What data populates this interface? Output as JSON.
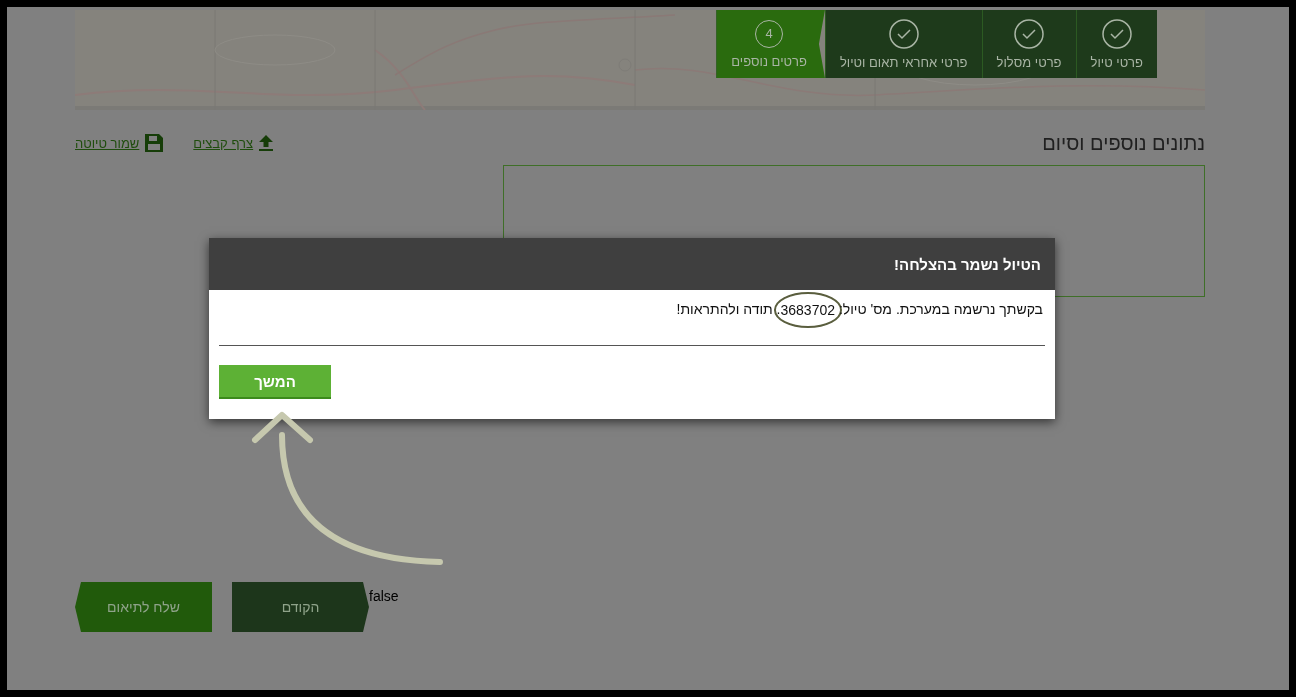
{
  "steps": [
    {
      "label": "פרטי טיול",
      "done": true,
      "selected": false
    },
    {
      "label": "פרטי מסלול",
      "done": true,
      "selected": false
    },
    {
      "label": "פרטי אחראי תאום וטיול",
      "done": true,
      "selected": false
    },
    {
      "label": "פרטים נוספים",
      "done": false,
      "number": "4",
      "selected": true
    }
  ],
  "section_title": "נתונים נוספים וסיום",
  "actions": [
    {
      "kind": "upload",
      "label": "צרף קבצים"
    },
    {
      "kind": "save",
      "label": "שמור טיוטה"
    }
  ],
  "nav_buttons": [
    {
      "kind": "previous",
      "label": "הקודם"
    },
    {
      "kind": "send",
      "label": "שלח לתיאום"
    }
  ],
  "debug_text": "false",
  "dialog": {
    "title": "הטיול נשמר בהצלחה!",
    "message_before": "בקשתך נרשמה במערכת. מס' טיול:",
    "trip_number": "3683702",
    "message_after": ". תודה ולהתראות!",
    "button": "המשך"
  }
}
